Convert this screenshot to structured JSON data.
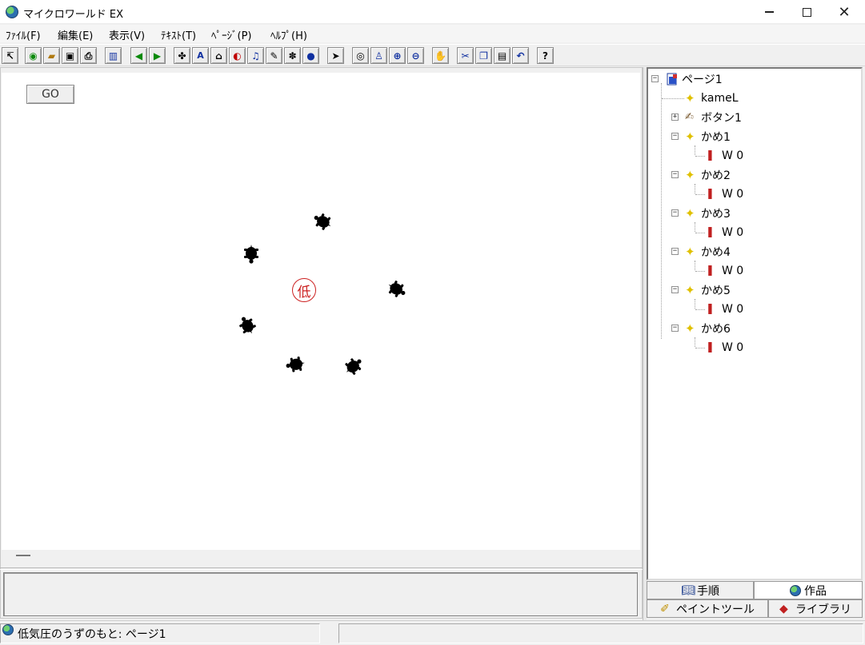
{
  "window": {
    "title": "マイクロワールド EX"
  },
  "menu": [
    "ﾌｧｲﾙ(F)",
    "編集(E)",
    "表示(V)",
    "ﾃｷｽﾄ(T)",
    "ﾍﾟｰｼﾞ(P)",
    "ﾍﾙﾌﾟ(H)"
  ],
  "toolbar": {
    "icons": [
      "pointer-icon",
      "globe-icon",
      "open-icon",
      "save-icon",
      "print-icon",
      "layout-icon",
      "prev-page-icon",
      "next-page-icon",
      "turtle-new-icon",
      "text-box-icon",
      "button-tool-icon",
      "paint-icon",
      "music-icon",
      "brush-icon",
      "movie-icon",
      "globe2-icon",
      "select-arrow-icon",
      "eye-icon",
      "stamp-icon",
      "zoom-in-icon",
      "zoom-out-icon",
      "stop-icon",
      "cut-icon",
      "copy-icon",
      "paste-icon",
      "undo-icon",
      "help-icon"
    ]
  },
  "canvas": {
    "go_button": "GO",
    "center_mark": "低",
    "turtles": [
      {
        "name": "かめ1"
      },
      {
        "name": "かめ2"
      },
      {
        "name": "かめ3"
      },
      {
        "name": "かめ4"
      },
      {
        "name": "かめ5"
      },
      {
        "name": "かめ6"
      }
    ],
    "colors": {
      "turtle": "#000000",
      "mark": "#cc2020"
    }
  },
  "tree": {
    "root": "ページ1",
    "items": [
      {
        "label": "kameL",
        "type": "turtle"
      },
      {
        "label": "ボタン1",
        "type": "button",
        "collapsed": true
      },
      {
        "label": "かめ1",
        "type": "turtle",
        "child": "W 0"
      },
      {
        "label": "かめ2",
        "type": "turtle",
        "child": "W 0"
      },
      {
        "label": "かめ3",
        "type": "turtle",
        "child": "W 0"
      },
      {
        "label": "かめ4",
        "type": "turtle",
        "child": "W 0"
      },
      {
        "label": "かめ5",
        "type": "turtle",
        "child": "W 0"
      },
      {
        "label": "かめ6",
        "type": "turtle",
        "child": "W 0"
      }
    ]
  },
  "tabs": {
    "procedures": "手順",
    "project": "作品",
    "paint_tools": "ペイントツール",
    "library": "ライブラリ"
  },
  "status": {
    "text": "低気圧のうずのもと: ページ1"
  }
}
